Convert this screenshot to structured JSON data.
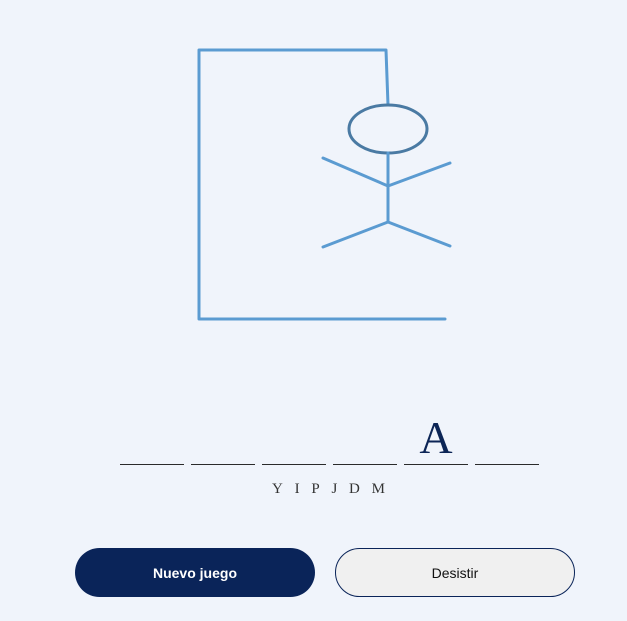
{
  "word": {
    "slots": [
      "",
      "",
      "",
      "",
      "A",
      ""
    ]
  },
  "wrong_letters": [
    "Y",
    "I",
    "P",
    "J",
    "D",
    "M"
  ],
  "buttons": {
    "new_game": "Nuevo juego",
    "give_up": "Desistir"
  },
  "colors": {
    "background": "#f0f4fb",
    "drawing_stroke": "#5b9bd1",
    "head_stroke": "#4a7aa3",
    "primary": "#0a2459"
  }
}
